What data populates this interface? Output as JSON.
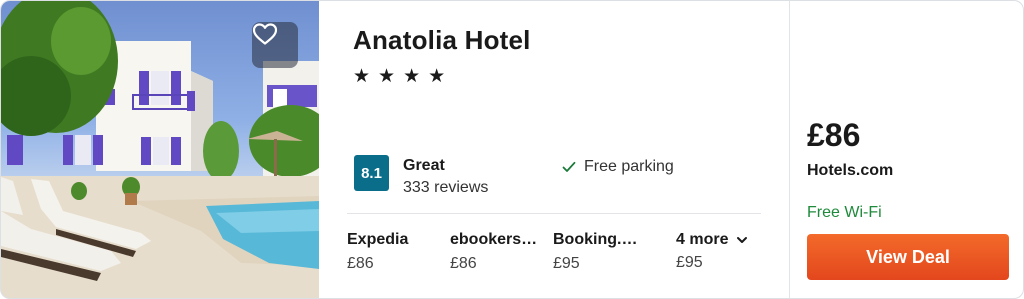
{
  "hotel": {
    "name": "Anatolia Hotel",
    "stars": [
      "★",
      "★",
      "★",
      "★"
    ]
  },
  "rating": {
    "score": "8.1",
    "label": "Great",
    "reviews": "333 reviews"
  },
  "amenity": {
    "label": "Free parking",
    "icon": "check-icon"
  },
  "providers": [
    {
      "name": "Expedia",
      "price": "£86"
    },
    {
      "name": "ebookers…",
      "price": "£86"
    },
    {
      "name": "Booking.…",
      "price": "£95"
    }
  ],
  "more": {
    "label": "4 more",
    "price": "£95"
  },
  "deal": {
    "price": "£86",
    "provider": "Hotels.com",
    "perk": "Free Wi-Fi",
    "button_label": "View Deal"
  },
  "colors": {
    "rating_badge": "#0a6e8a",
    "perk_text": "#1f8a3b",
    "deal_button": "#f05a24"
  }
}
